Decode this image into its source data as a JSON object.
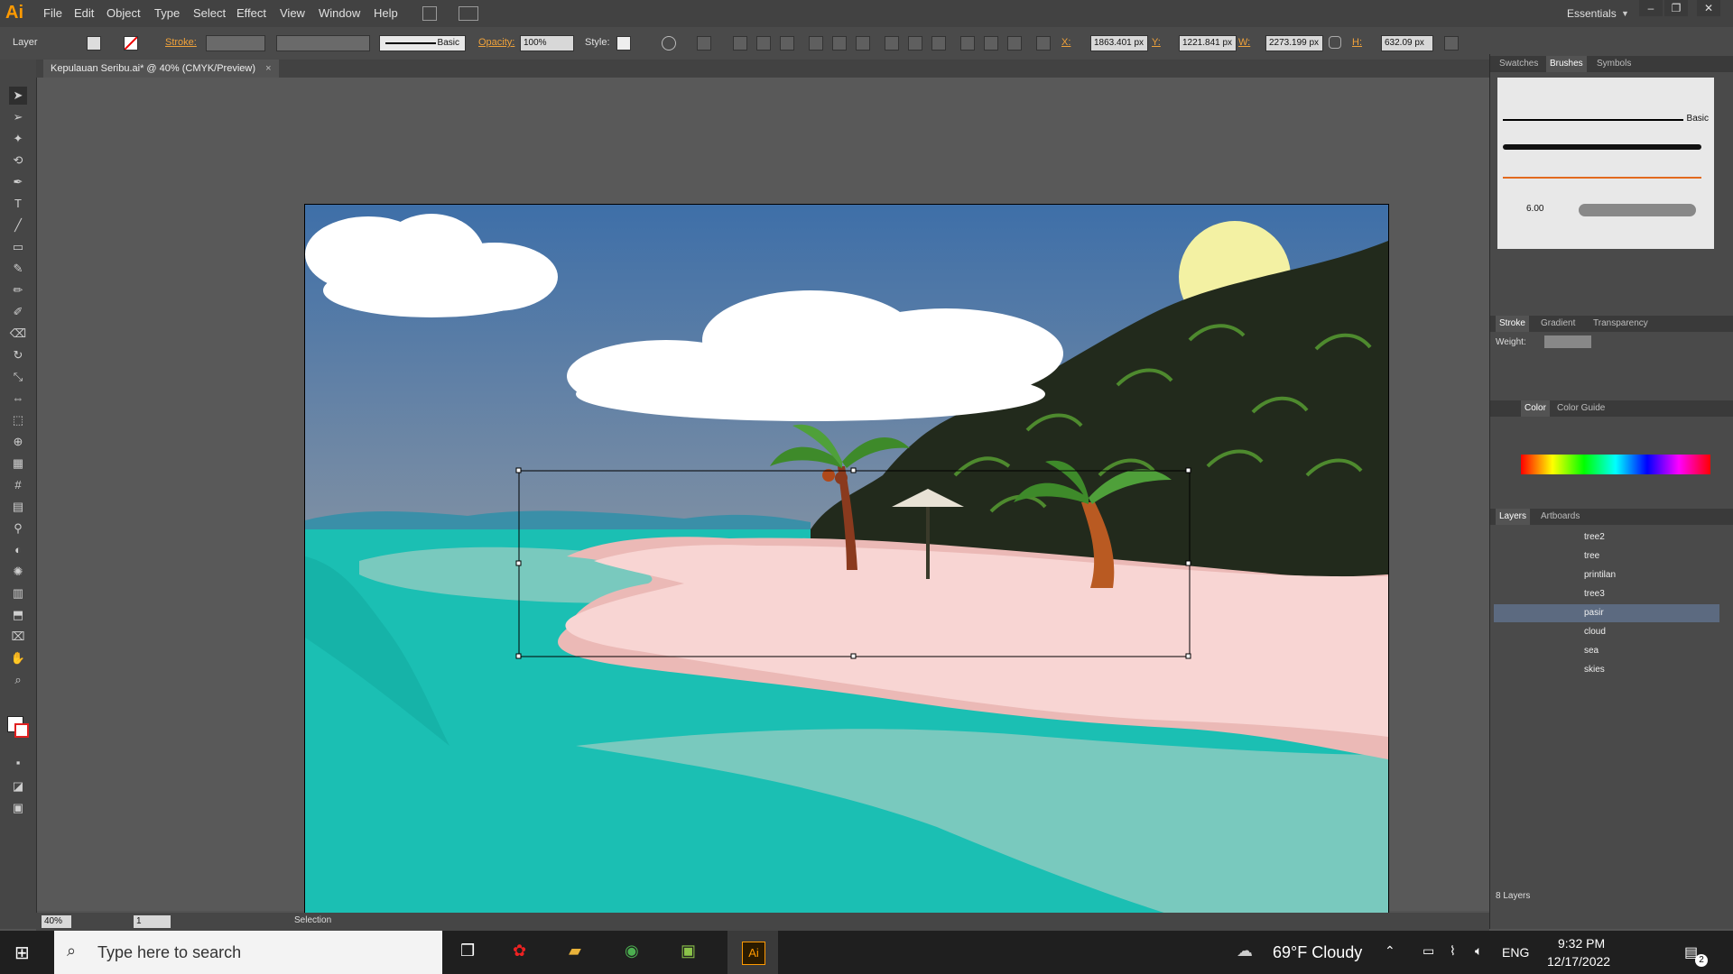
{
  "app": {
    "name": "Ai",
    "logo_color": "#FF9A00"
  },
  "menu": {
    "items": [
      "File",
      "Edit",
      "Object",
      "Type",
      "Select",
      "Effect",
      "View",
      "Window",
      "Help"
    ],
    "workspace": "Essentials"
  },
  "controlbar": {
    "layer_label": "Layer",
    "stroke_label": "Stroke:",
    "brush_label": "Basic",
    "opacity_label": "Opacity:",
    "opacity_value": "100%",
    "style_label": "Style:",
    "x_label": "X:",
    "x_value": "1863.401 px",
    "y_label": "Y:",
    "y_value": "1221.841 px",
    "w_label": "W:",
    "w_value": "2273.199 px",
    "h_label": "H:",
    "h_value": "632.09 px"
  },
  "document": {
    "tab_title": "Kepulauan Seribu.ai* @ 40% (CMYK/Preview)"
  },
  "status": {
    "zoom": "40%",
    "artboard": "1",
    "tool": "Selection"
  },
  "panels": {
    "top_tabs": [
      "Swatches",
      "Brushes",
      "Symbols"
    ],
    "brush_value": "6.00",
    "basic_label": "Basic",
    "stroke_tabs": [
      "Stroke",
      "Gradient",
      "Transparency"
    ],
    "weight_label": "Weight:",
    "color_tabs": [
      "Color",
      "Color Guide"
    ],
    "layer_tabs": [
      "Layers",
      "Artboards"
    ],
    "layers": [
      {
        "name": "tree2",
        "color": "#3b6bd6"
      },
      {
        "name": "tree",
        "color": "#e03b3b"
      },
      {
        "name": "printilan",
        "color": "#3fbf3f"
      },
      {
        "name": "tree3",
        "color": "#3b6bd6"
      },
      {
        "name": "pasir",
        "color": "#e6e6e6"
      },
      {
        "name": "cloud",
        "color": "#d43bd4"
      },
      {
        "name": "sea",
        "color": "#d43b8a"
      },
      {
        "name": "skies",
        "color": "#4fc3f7"
      }
    ],
    "layers_count": "8 Layers"
  },
  "taskbar": {
    "search_placeholder": "Type here to search",
    "weather": "69°F  Cloudy",
    "language": "ENG",
    "time": "9:32 PM",
    "date": "12/17/2022",
    "notifications": "2",
    "active_app": "Ai"
  },
  "colors": {
    "sky_top": "#3E6FA8",
    "sky_bottom": "#7A8FA6",
    "sea": "#1BBFB3",
    "sea_light": "#78C8BC",
    "sand": "#F8D5D3",
    "sand_shadow": "#E8B8B6",
    "jungle": "#222A1C",
    "sun": "#F3F1A3"
  }
}
